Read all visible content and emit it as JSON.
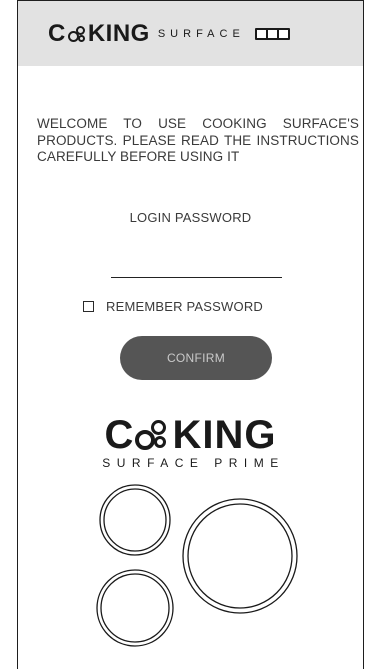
{
  "header": {
    "brand_word_prefix": "C",
    "brand_word_suffix": "KING",
    "brand_sub": "SURFACE",
    "battery_icon": "battery-icon"
  },
  "welcome_text": "WELCOME TO USE COOKING SURFACE'S PRODUCTS. PLEASE READ THE INSTRUCTIONS CAREFULLY BEFORE USING IT",
  "login": {
    "label": "LOGIN PASSWORD",
    "password_value": "",
    "remember_label": "REMEMBER PASSWORD",
    "remember_checked": false,
    "confirm_label": "CONFIRM"
  },
  "logo": {
    "word_prefix": "C",
    "word_suffix": "KING",
    "sub": "SURFACE PRIME"
  },
  "colors": {
    "header_bg": "#e2e2e2",
    "button_bg": "#555555",
    "button_text": "#c9c9c9",
    "ink": "#1a1a1a"
  }
}
